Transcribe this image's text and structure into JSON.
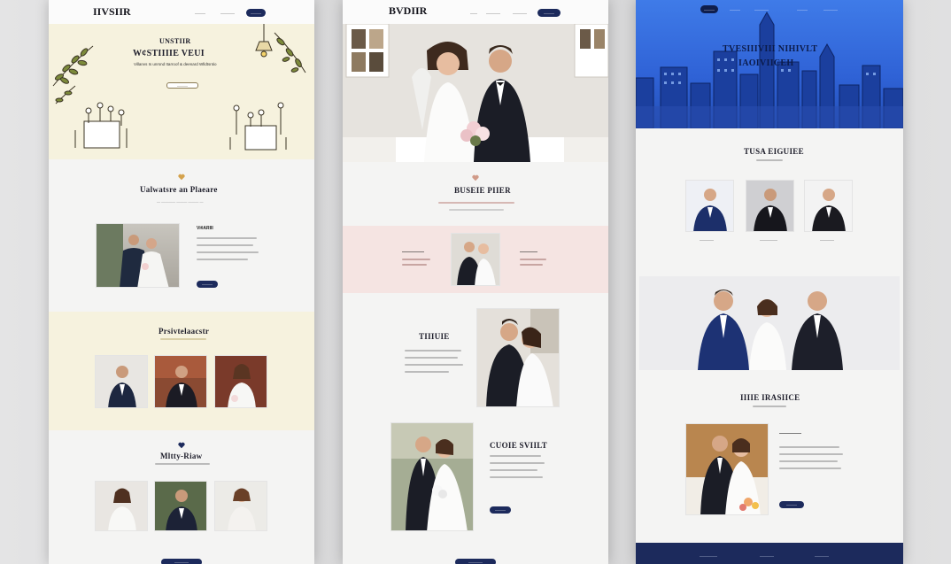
{
  "page1": {
    "logo": "IIVSIIR",
    "nav": [
      "———",
      "————"
    ],
    "nav_button": "———",
    "hero_title_1": "UNSTIIR",
    "hero_title_2": "W¢STIIIIE VEUI",
    "hero_sub": "Villanvs Is unrsnd Itarroof & deenard Wlldtsntio",
    "hero_button": "———",
    "section1_title": "Ualwatsre an Plaeare",
    "section1_sub": "— ———— ——— ——— —",
    "feature_title": "Vi¢ARIII",
    "feature_button": "———",
    "section2_title": "Prsivtelaacstr",
    "section3_title": "Mltty-Riaw",
    "footer_button": "————"
  },
  "page2": {
    "logo": "BVDIIR",
    "nav": [
      "——",
      "————",
      "————"
    ],
    "nav_button": "———",
    "section1_title": "BUSEIE PIIER",
    "left_card_title": "—————",
    "right_card_title": "————",
    "story_title": "TIIIUIE",
    "story2_title": "CUOIE SVIILT",
    "story2_button": "———",
    "footer_button": "————"
  },
  "page3": {
    "nav": [
      "———",
      "———",
      "————",
      "———",
      "————"
    ],
    "hero_title_1": "TVESIIIVIII NIHIVLT",
    "hero_title_2": "IAOIVIICEH",
    "team_title": "TUSA EIGUIEE",
    "team_captions": [
      "————",
      "—————",
      "————"
    ],
    "section_title": "IIIIE IRASIICE",
    "feature_title": "—————",
    "feature_button": "———",
    "footer_links": [
      "—————",
      "————",
      "————"
    ]
  },
  "colors": {
    "navy": "#1c2a5c",
    "cream": "#f6f2de",
    "blush": "#f5e4e2",
    "sky": "#2f62d6"
  }
}
